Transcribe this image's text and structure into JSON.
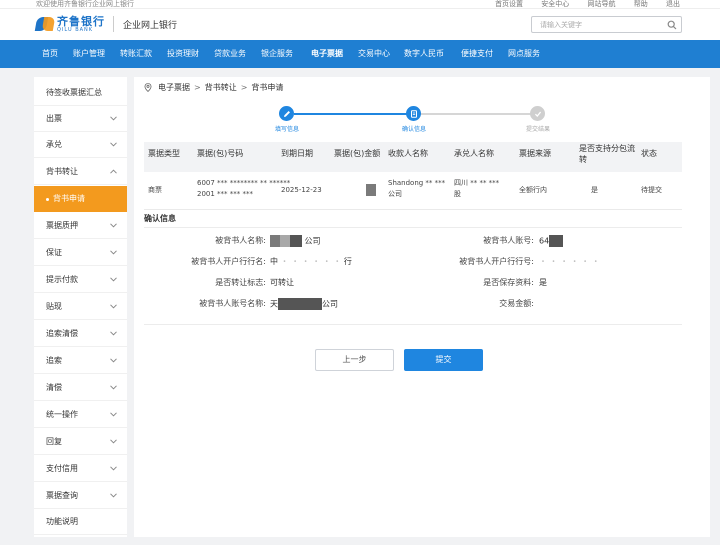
{
  "top_bar": {
    "welcome": "欢迎使用齐鲁银行企业网上银行",
    "links": [
      "首页设置",
      "安全中心",
      "网站导航",
      "帮助",
      "退出"
    ]
  },
  "header": {
    "logo_cn": "齐鲁银行",
    "logo_en": "QILU BANK",
    "subtitle": "企业网上银行",
    "search_placeholder": "请输入关键字"
  },
  "nav": {
    "items": [
      "首页",
      "账户管理",
      "转账汇款",
      "投资理财",
      "贷款业务",
      "银企服务",
      "电子票据",
      "交易中心",
      "数字人民币",
      "便捷支付",
      "网点服务"
    ],
    "active_index": 6
  },
  "sidebar": {
    "items": [
      {
        "label": "待签收票据汇总",
        "chevron": false
      },
      {
        "label": "出票",
        "chevron": true
      },
      {
        "label": "承兑",
        "chevron": true
      },
      {
        "label": "背书转让",
        "chevron": true,
        "expanded": true
      },
      {
        "label": "票据质押",
        "chevron": true
      },
      {
        "label": "保证",
        "chevron": true
      },
      {
        "label": "提示付款",
        "chevron": true
      },
      {
        "label": "贴现",
        "chevron": true
      },
      {
        "label": "追索清偿",
        "chevron": true
      },
      {
        "label": "追索",
        "chevron": true
      },
      {
        "label": "清偿",
        "chevron": true
      },
      {
        "label": "统一操作",
        "chevron": true
      },
      {
        "label": "回复",
        "chevron": true
      },
      {
        "label": "支付信用",
        "chevron": true
      },
      {
        "label": "票据查询",
        "chevron": true
      },
      {
        "label": "功能说明",
        "chevron": false
      }
    ],
    "sub_item": "背书申请"
  },
  "breadcrumb": [
    "电子票据",
    "背书转让",
    "背书申请"
  ],
  "steps": [
    {
      "label": "填写信息",
      "state": "done"
    },
    {
      "label": "确认信息",
      "state": "current"
    },
    {
      "label": "提交结果",
      "state": "pending"
    }
  ],
  "table": {
    "headers": [
      "票据类型",
      "票据(包)号码",
      "到期日期",
      "票据(包)金额",
      "收款人名称",
      "承兑人名称",
      "票据来源",
      "是否支持分包流转",
      "状态"
    ],
    "row": {
      "type": "商票",
      "number_line1": "6007 *** ******** ** ******",
      "number_line2": "2001 *** *** ***",
      "due_date": "2025-12-23",
      "payee_line1": "Shandong ** ***",
      "payee_line2": "公司",
      "acceptor_line1": "四川 ** ** ***",
      "acceptor_line2": "股",
      "source": "全额行内",
      "split": "是",
      "status": "待提交"
    }
  },
  "confirm": {
    "title": "确认信息",
    "fields": [
      {
        "label": "被背书人名称:",
        "value": "中",
        "value_suffix": "公司"
      },
      {
        "label": "被背书人账号:",
        "value": "64"
      },
      {
        "label": "被背书人开户行行名:",
        "value": "中",
        "value_suffix": "行"
      },
      {
        "label": "被背书人开户行行号:",
        "value": ""
      },
      {
        "label": "是否转让标志:",
        "value": "可转让"
      },
      {
        "label": "是否保存资料:",
        "value": "是"
      },
      {
        "label": "被背书人账号名称:",
        "value": "天",
        "value_suffix": "公司"
      },
      {
        "label": "交易金额:",
        "value": ""
      }
    ]
  },
  "buttons": {
    "prev": "上一步",
    "submit": "提交"
  },
  "colors": {
    "nav_bg": "#1f7fd2",
    "accent_orange": "#f39a1e",
    "primary_button": "#1f86e0",
    "step_active": "#1f86e0",
    "step_pending": "#c8c8c8"
  }
}
